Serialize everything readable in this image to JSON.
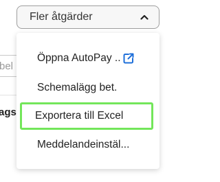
{
  "background": {
    "input_placeholder_fragment": "bel",
    "label_fragment": "ags"
  },
  "actions_button": {
    "label": "Fler åtgärder",
    "icon": "chevron-up-icon"
  },
  "menu": {
    "items": [
      {
        "label": "Öppna AutoPay ..",
        "icon": "external-link-icon"
      },
      {
        "label": "Schemalägg bet."
      },
      {
        "label": "Exportera till Excel",
        "highlighted": true
      },
      {
        "label": "Meddelandeinstäl..."
      }
    ]
  },
  "colors": {
    "link_icon": "#1e6fd9",
    "highlight_border": "#73e65a"
  }
}
